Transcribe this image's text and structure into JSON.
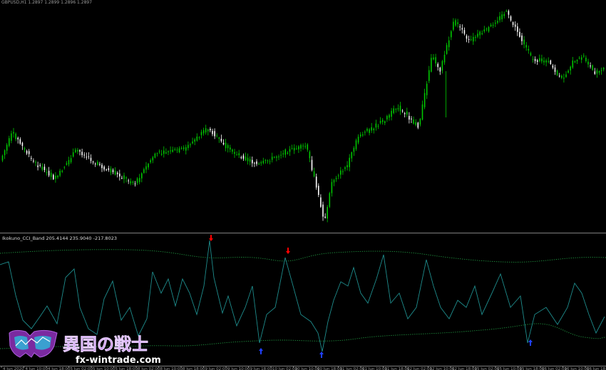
{
  "main_chart": {
    "header": "GBPUSD,H1 1.2897 1.2899 1.2896 1.2897",
    "bull_color": "#00c800",
    "bear_color": "#ffffff"
  },
  "indicator": {
    "label": "Ikokuno_CCI_Band 205.4144 235.9040 -217.8023",
    "cci_color": "#1e8c8c",
    "band_color": "#1e8c3c",
    "sell_arrow_color": "#ff0000",
    "buy_arrow_color": "#2040ff"
  },
  "time_axis": {
    "labels": [
      "4 Jun 2020",
      "4 Jun 10:00",
      "4 Jun 18:00",
      "5 Jun 02:00",
      "5 Jun 10:00",
      "5 Jun 18:00",
      "8 Jun 02:00",
      "8 Jun 10:00",
      "8 Jun 18:00",
      "9 Jun 02:00",
      "9 Jun 10:00",
      "9 Jun 18:00",
      "10 Jun 02:00",
      "10 Jun 10:00",
      "10 Jun 18:00",
      "11 Jun 02:00",
      "11 Jun 10:00",
      "11 Jun 18:00",
      "12 Jun 02:00",
      "12 Jun 10:00",
      "12 Jun 18:00",
      "15 Jun 02:00",
      "15 Jun 10:00",
      "15 Jun 18:00",
      "16 Jun 02:00",
      "16 Jun 10:00",
      "16 Jun 18:00"
    ]
  },
  "watermark": {
    "title": "異国の戦士",
    "url": "fx-wintrade.com"
  }
}
